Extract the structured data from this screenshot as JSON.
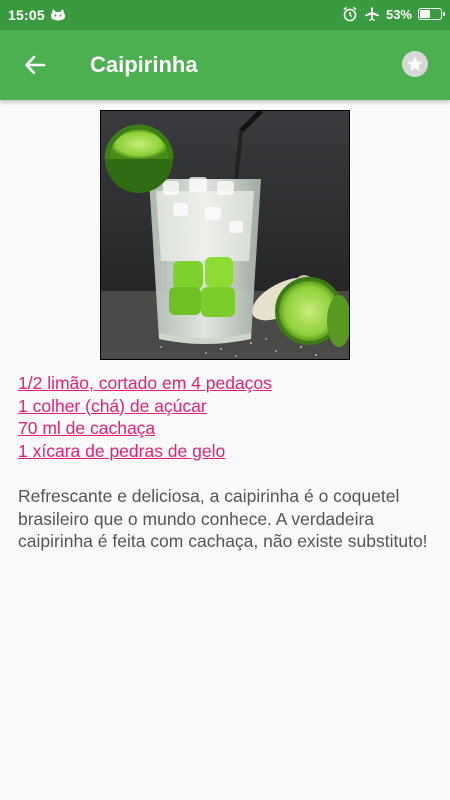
{
  "status_bar": {
    "time": "15:05",
    "battery_percent": "53%",
    "battery_level": 0.53
  },
  "app_bar": {
    "title": "Caipirinha",
    "back_icon": "arrow-left-icon",
    "favorite_icon": "star-icon"
  },
  "recipe": {
    "ingredients": [
      "1/2 limão, cortado em 4 pedaços",
      "1 colher (chá) de açúcar",
      "70 ml de cachaça",
      "1 xícara de pedras de gelo"
    ],
    "description": "Refrescante e deliciosa, a caipirinha é o coquetel brasileiro que o mundo conhece. A verdadeira caipirinha é feita com cachaça, não existe substituto!"
  },
  "colors": {
    "status_bar": "#3a9a3f",
    "app_bar": "#4caf50",
    "ingredient_link": "#e91e78",
    "body_text": "#555555",
    "background": "#fafafa"
  }
}
